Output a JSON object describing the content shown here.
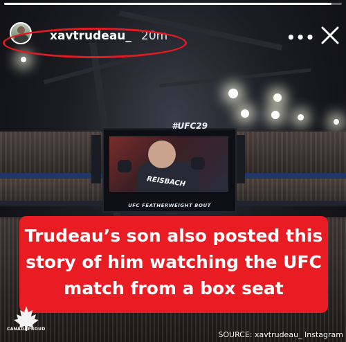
{
  "story": {
    "username": "xavtrudeau_",
    "time_ago": "20m",
    "more_label": "•••",
    "progress": 0.97
  },
  "scene": {
    "jumbotron_hashtag": "#UFC29",
    "fighter_shorts_text": "REISBACH",
    "jumbotron_caption": "UFC FEATHERWEIGHT BOUT"
  },
  "caption": {
    "line1": "Trudeau’s son also posted this",
    "line2": "story of him watching the UFC",
    "line3": "match from a box seat"
  },
  "watermark": {
    "logo_text": "CANADAPROUD"
  },
  "source_credit": "SOURCE: xavtrudeau_ Instagram",
  "colors": {
    "callout": "#ea1c23",
    "highlight_ring": "#e01b22"
  },
  "icons": {
    "more": "more-horizontal-icon",
    "close": "close-icon",
    "logo": "maple-leaf-icon"
  }
}
